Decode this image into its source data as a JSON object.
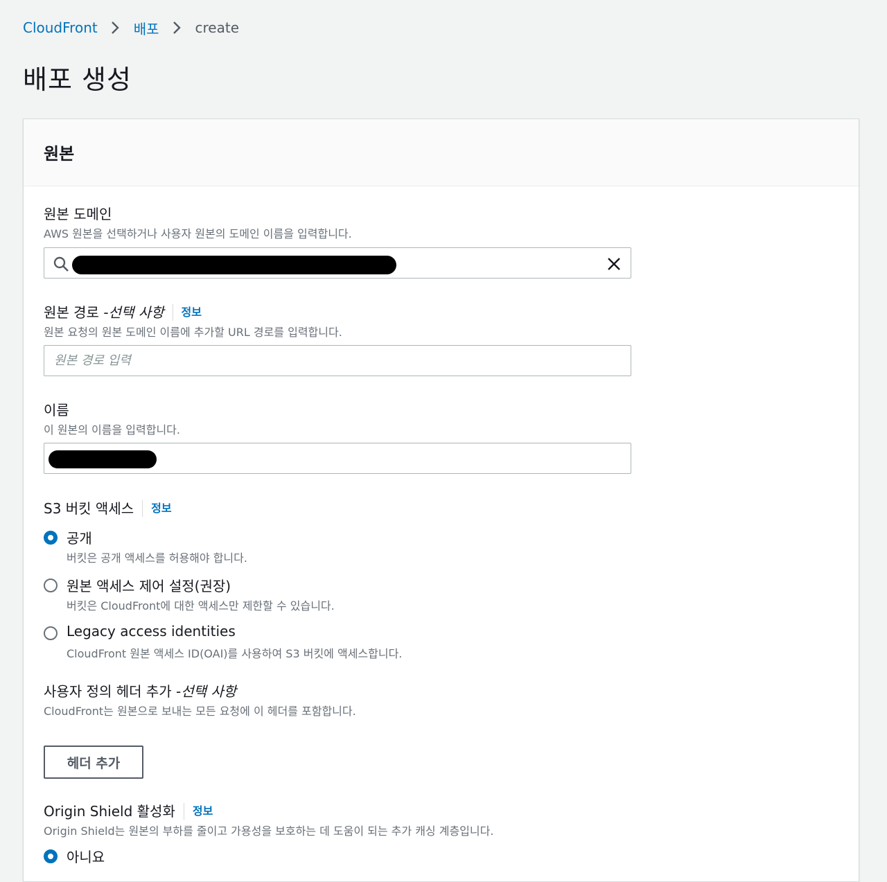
{
  "breadcrumb": {
    "items": [
      "CloudFront",
      "배포",
      "create"
    ]
  },
  "page": {
    "title": "배포 생성"
  },
  "panel": {
    "title": "원본"
  },
  "origin_domain": {
    "label": "원본 도메인",
    "description": "AWS 원본을 선택하거나 사용자 원본의 도메인 이름을 입력합니다.",
    "value": ""
  },
  "origin_path": {
    "label": "원본 경로 - ",
    "optional": "선택 사항",
    "info": "정보",
    "description": "원본 요청의 원본 도메인 이름에 추가할 URL 경로를 입력합니다.",
    "placeholder": "원본 경로 입력"
  },
  "name": {
    "label": "이름",
    "description": "이 원본의 이름을 입력합니다.",
    "value": ""
  },
  "s3_access": {
    "label": "S3 버킷 액세스",
    "info": "정보",
    "options": [
      {
        "label": "공개",
        "description": "버킷은 공개 액세스를 허용해야 합니다.",
        "selected": true
      },
      {
        "label": "원본 액세스 제어 설정(권장)",
        "description": "버킷은 CloudFront에 대한 액세스만 제한할 수 있습니다.",
        "selected": false
      },
      {
        "label": "Legacy access identities",
        "description": "CloudFront 원본 액세스 ID(OAI)를 사용하여 S3 버킷에 액세스합니다.",
        "selected": false
      }
    ]
  },
  "custom_header": {
    "label": "사용자 정의 헤더 추가 - ",
    "optional": "선택 사항",
    "description": "CloudFront는 원본으로 보내는 모든 요청에 이 헤더를 포함합니다.",
    "button": "헤더 추가"
  },
  "origin_shield": {
    "label": "Origin Shield 활성화",
    "info": "정보",
    "description": "Origin Shield는 원본의 부하를 줄이고 가용성을 보호하는 데 도움이 되는 추가 캐싱 계층입니다.",
    "options": [
      {
        "label": "아니요",
        "selected": true
      }
    ]
  },
  "colors": {
    "link": "#0073bb",
    "background": "#f2f3f3",
    "text": "#16191f",
    "secondary_text": "#687078"
  }
}
